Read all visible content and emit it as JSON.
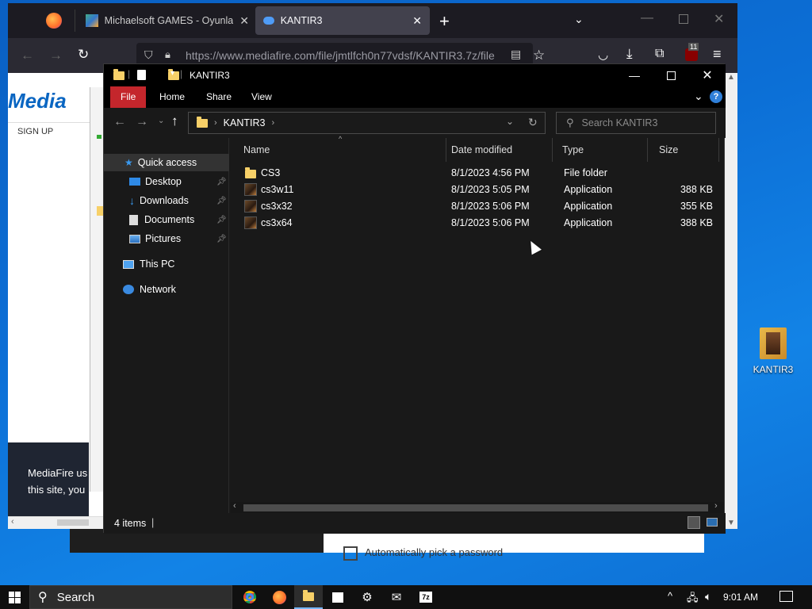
{
  "browser": {
    "tabs": [
      {
        "title": "Michaelsoft GAMES - Oyunların"
      },
      {
        "title": "KANTIR3"
      }
    ],
    "url": "https://www.mediafire.com/file/jmtlfch0n77vdsf/KANTIR3.7z/file",
    "extension_badge": "11",
    "page": {
      "logo_text": "Media",
      "signup": "SIGN UP",
      "notice_line1": "MediaFire us",
      "notice_line2": "this site, you",
      "automatic_text": "Automatically pick a password"
    }
  },
  "explorer": {
    "title": "KANTIR3",
    "ribbon": {
      "file": "File",
      "home": "Home",
      "share": "Share",
      "view": "View"
    },
    "breadcrumb": "KANTIR3",
    "search_placeholder": "Search KANTIR3",
    "nav": {
      "quick_access": "Quick access",
      "desktop": "Desktop",
      "downloads": "Downloads",
      "documents": "Documents",
      "pictures": "Pictures",
      "this_pc": "This PC",
      "network": "Network"
    },
    "columns": {
      "name": "Name",
      "date": "Date modified",
      "type": "Type",
      "size": "Size"
    },
    "rows": [
      {
        "name": "CS3",
        "date": "8/1/2023 4:56 PM",
        "type": "File folder",
        "size": ""
      },
      {
        "name": "cs3w11",
        "date": "8/1/2023 5:05 PM",
        "type": "Application",
        "size": "388 KB"
      },
      {
        "name": "cs3x32",
        "date": "8/1/2023 5:06 PM",
        "type": "Application",
        "size": "355 KB"
      },
      {
        "name": "cs3x64",
        "date": "8/1/2023 5:06 PM",
        "type": "Application",
        "size": "388 KB"
      }
    ],
    "status": "4 items"
  },
  "desktop": {
    "icon_label": "KANTIR3"
  },
  "taskbar": {
    "search": "Search",
    "time": "9:01 AM"
  }
}
